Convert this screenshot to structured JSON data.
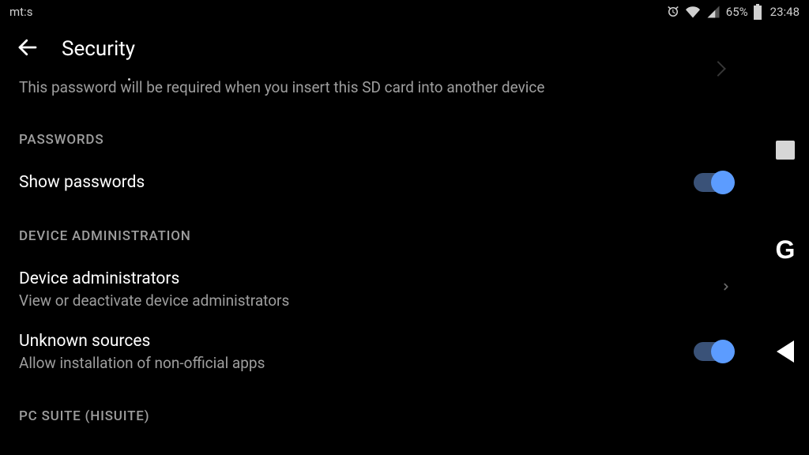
{
  "statusBar": {
    "carrier": "mt:s",
    "batteryPct": "65%",
    "time": "23:48"
  },
  "appBar": {
    "title": "Security"
  },
  "truncatedItem": {
    "description": "This password will be required when you insert this SD card into another device"
  },
  "sections": [
    {
      "header": "PASSWORDS",
      "items": [
        {
          "title": "Show passwords",
          "subtitle": null,
          "control": "toggle",
          "value": true
        }
      ]
    },
    {
      "header": "DEVICE ADMINISTRATION",
      "items": [
        {
          "title": "Device administrators",
          "subtitle": "View or deactivate device administrators",
          "control": "chevron"
        },
        {
          "title": "Unknown sources",
          "subtitle": "Allow installation of non-official apps",
          "control": "toggle",
          "value": true
        }
      ]
    },
    {
      "header": "PC SUITE (HISUITE)",
      "items": []
    }
  ],
  "navBar": {
    "homeGlyph": "G"
  }
}
